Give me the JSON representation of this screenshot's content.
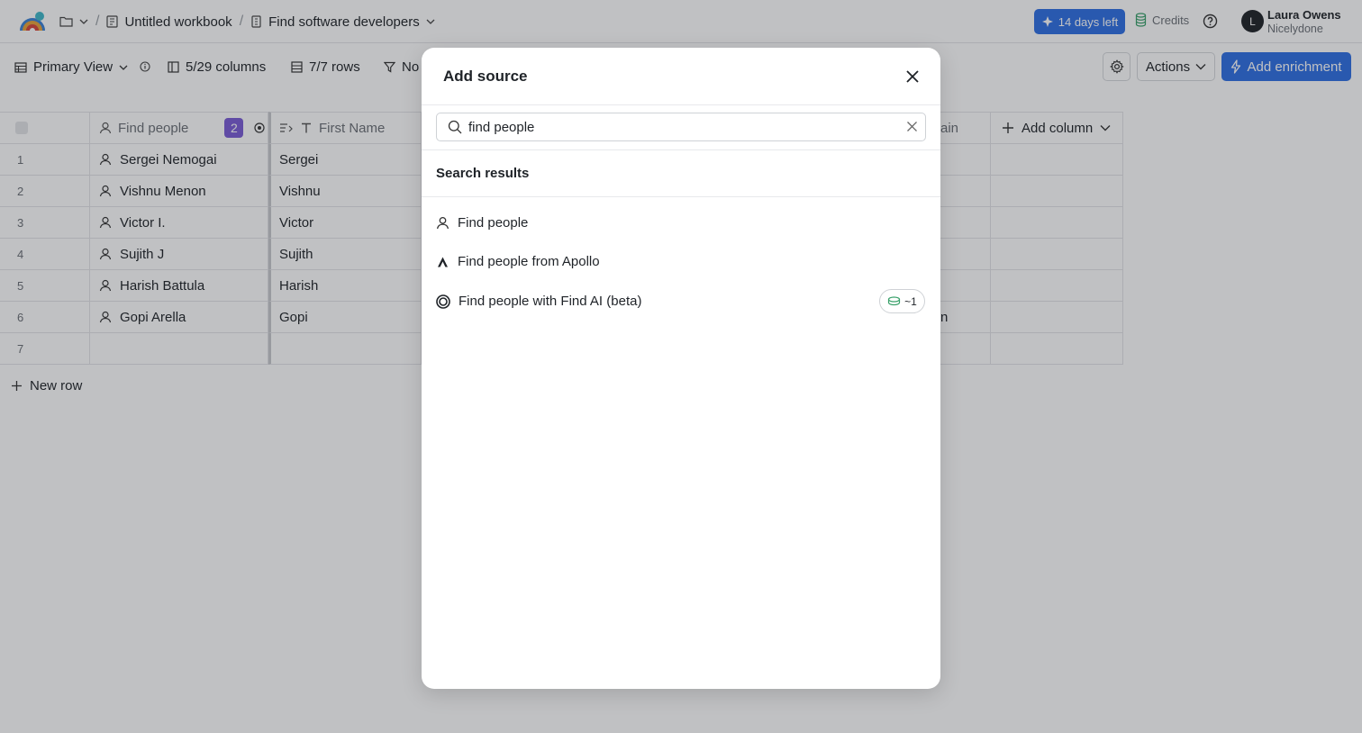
{
  "topbar": {
    "breadcrumb": [
      "Untitled workbook",
      "Find software developers"
    ],
    "trial_label": "14 days left",
    "credits_label": "Credits",
    "user": {
      "initial": "L",
      "name": "Laura Owens",
      "org": "Nicelydone"
    }
  },
  "toolbar": {
    "view_label": "Primary View",
    "columns_label": "5/29 columns",
    "rows_label": "7/7 rows",
    "filter_label": "No",
    "actions_label": "Actions",
    "enrich_label": "Add enrichment"
  },
  "table": {
    "headers": {
      "find_people": "Find people",
      "find_people_badge": "2",
      "first_name": "First Name",
      "domain_partial": "ain",
      "add_column": "Add column"
    },
    "rows": [
      {
        "num": "1",
        "person": "Sergei Nemogai",
        "first": "Sergei",
        "domain": ""
      },
      {
        "num": "2",
        "person": "Vishnu Menon",
        "first": "Vishnu",
        "domain": ""
      },
      {
        "num": "3",
        "person": "Victor I.",
        "first": "Victor",
        "domain": ""
      },
      {
        "num": "4",
        "person": "Sujith J",
        "first": "Sujith",
        "domain": ""
      },
      {
        "num": "5",
        "person": "Harish Battula",
        "first": "Harish",
        "domain": ""
      },
      {
        "num": "6",
        "person": "Gopi Arella",
        "first": "Gopi",
        "domain": "n"
      },
      {
        "num": "7",
        "person": "",
        "first": "",
        "domain": ""
      }
    ],
    "new_row_label": "New row"
  },
  "modal": {
    "title": "Add source",
    "search_value": "find people",
    "results_title": "Search results",
    "results": [
      {
        "label": "Find people",
        "icon": "person-icon"
      },
      {
        "label": "Find people from Apollo",
        "icon": "apollo-icon"
      },
      {
        "label": "Find people with Find AI (beta)",
        "icon": "find-ai-icon",
        "cost": "~1"
      }
    ]
  },
  "colors": {
    "primary": "#2f6fe4",
    "badge_purple": "#7b5cd6",
    "overlay": "rgba(30,32,38,0.28)",
    "credits_green": "#3aa16b"
  }
}
